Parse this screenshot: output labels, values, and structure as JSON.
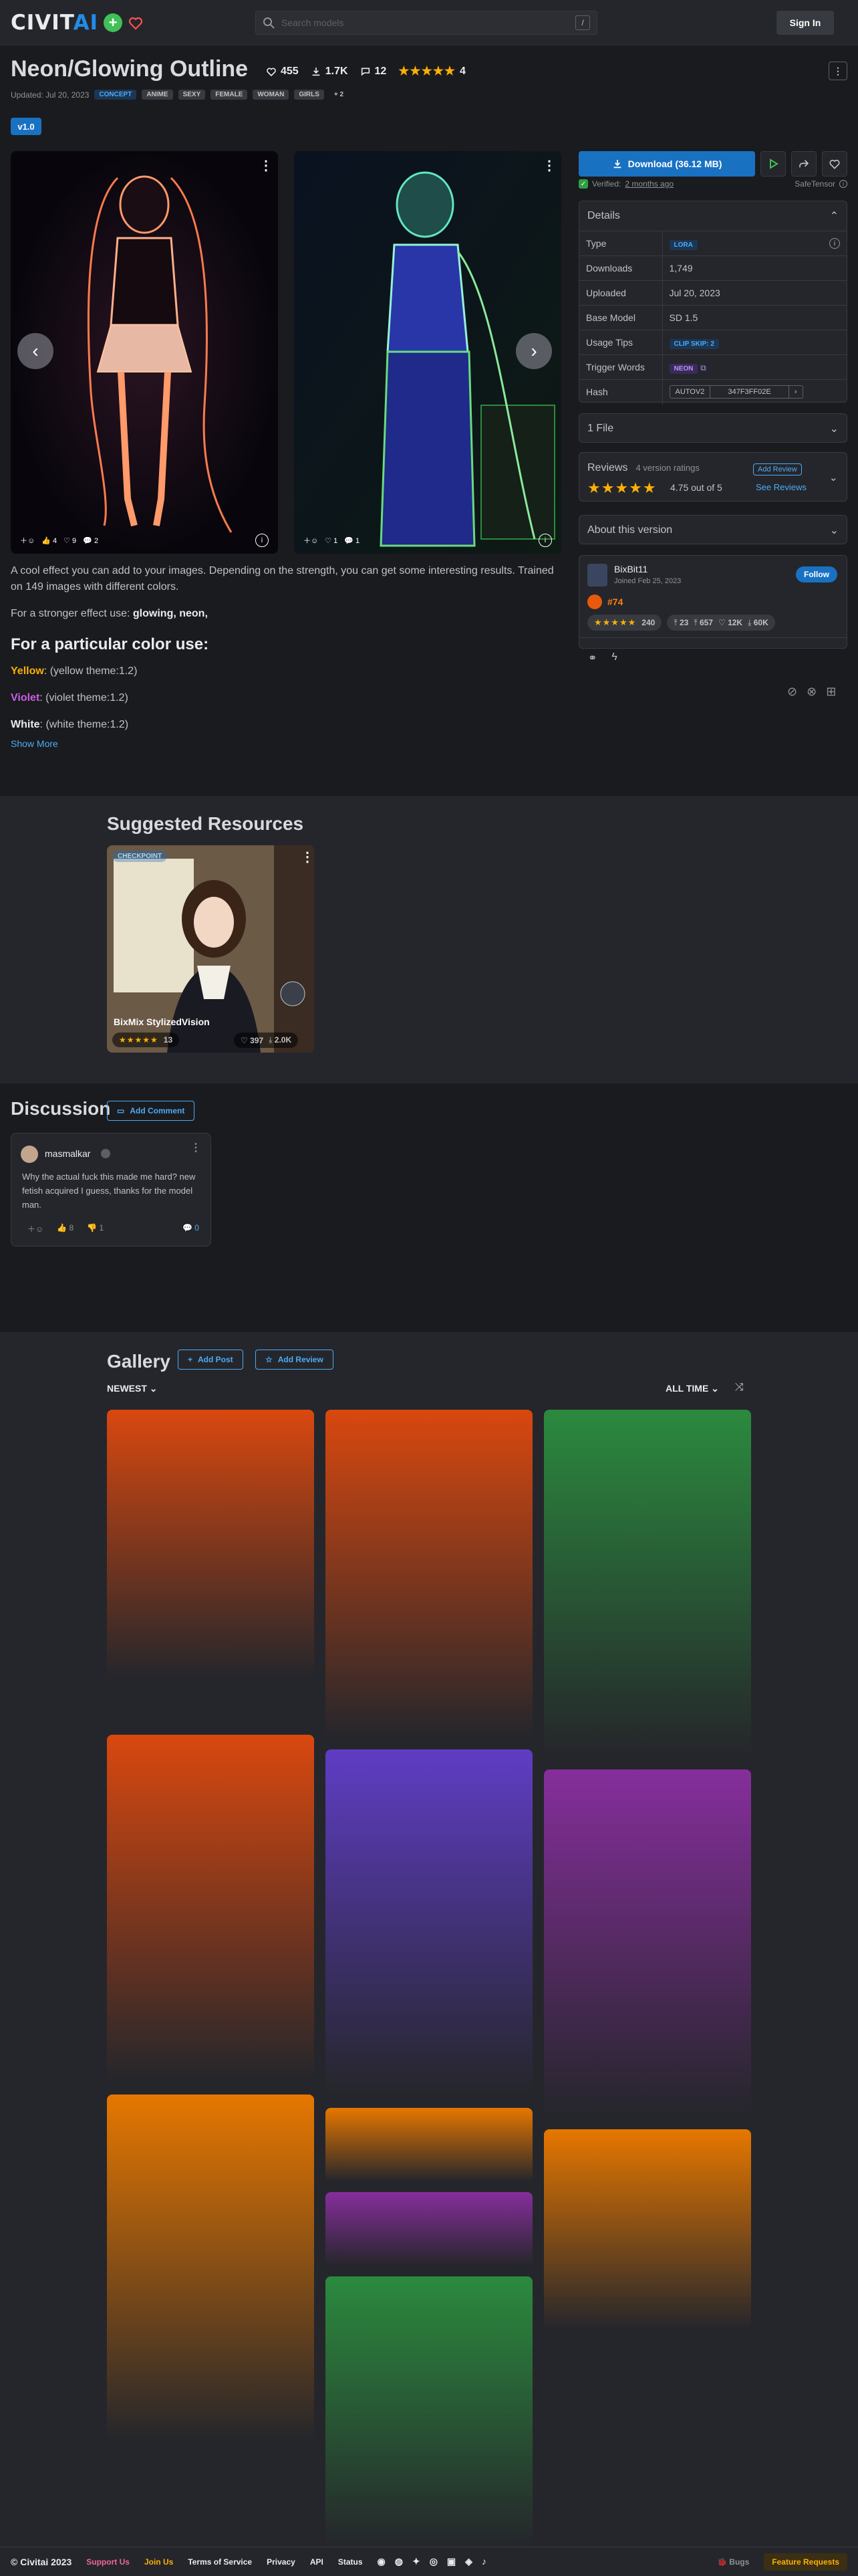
{
  "header": {
    "logo_main": "CIVIT",
    "logo_accent": "AI",
    "search_placeholder": "Search models",
    "search_shortcut": "/",
    "signin_label": "Sign In"
  },
  "model": {
    "title": "Neon/Glowing Outline",
    "likes": "455",
    "downloads": "1.7K",
    "comments": "12",
    "rating_stars": "★★★★★",
    "rating_count": "4",
    "updated": "Updated: Jul 20, 2023",
    "tags": [
      "CONCEPT",
      "ANIME",
      "SEXY",
      "FEMALE",
      "WOMAN",
      "GIRLS",
      "+ 2"
    ],
    "version_label": "v1.0",
    "menu_label": "⋮"
  },
  "carousel": {
    "images": [
      {
        "reactions": "4",
        "likes": "9",
        "comments": "2"
      },
      {
        "reactions": "1",
        "likes": "1",
        "comments": ""
      }
    ]
  },
  "description": {
    "p1": "A cool effect you can add to your images. Depending on the strength, you can get some interesting results. Trained on 149 images with different colors.",
    "p2_prefix": "For a stronger effect use: ",
    "p2_strong": "glowing, neon,",
    "heading": "For a particular color use:",
    "colors": [
      {
        "name": "Yellow",
        "rest": ": (yellow theme:1.2)",
        "color": "#fab005"
      },
      {
        "name": "Violet",
        "rest": ": (violet theme:1.2)",
        "color": "#cc5de8"
      },
      {
        "name": "White",
        "rest": ": (white theme:1.2)",
        "color": "#e9ecef"
      }
    ],
    "show_more": "Show More"
  },
  "download": {
    "label": "Download (36.12 MB)",
    "verified_prefix": "Verified: ",
    "verified_time": "2 months ago",
    "safetensor": "SafeTensor"
  },
  "details": {
    "title": "Details",
    "rows": [
      {
        "label": "Type",
        "value": "LORA"
      },
      {
        "label": "Downloads",
        "value": "1,749"
      },
      {
        "label": "Uploaded",
        "value": "Jul 20, 2023"
      },
      {
        "label": "Base Model",
        "value": "SD 1.5"
      },
      {
        "label": "Usage Tips",
        "value": "CLIP SKIP: 2"
      },
      {
        "label": "Trigger Words",
        "value": "NEON"
      },
      {
        "label": "Hash",
        "value": "AUTOV2",
        "hash": "347F3FF02E"
      }
    ]
  },
  "files": {
    "label": "1 File"
  },
  "reviews": {
    "title": "Reviews",
    "subtitle": "4 version ratings",
    "stars": "★★★★★",
    "score": "4.75 out of 5",
    "add_review": "Add Review",
    "see_reviews": "See Reviews"
  },
  "about": {
    "label": "About this version"
  },
  "creator": {
    "name": "BixBit11",
    "joined": "Joined Feb 25, 2023",
    "follow": "Follow",
    "rank": "#74",
    "stars": "★★★★★",
    "rating": "240",
    "uploads": "23",
    "downloads_up": "657",
    "likes": "12K",
    "downloads": "60K"
  },
  "suggested": {
    "title": "Suggested Resources",
    "card": {
      "badge": "CHECKPOINT",
      "name": "BixMix StylizedVision",
      "stars": "★★★★★",
      "rating": "13",
      "likes": "397",
      "downloads": "2.0K"
    }
  },
  "discussion": {
    "title": "Discussion",
    "add_comment": "Add Comment",
    "comment": {
      "user": "masmalkar",
      "text": "Why the actual fuck this made me hard? new fetish acquired I guess, thanks for the model man.",
      "likes": "8",
      "dislikes": "1",
      "replies": "0"
    }
  },
  "gallery": {
    "title": "Gallery",
    "add_post": "Add Post",
    "add_review": "Add Review",
    "sort": "NEWEST",
    "period": "ALL TIME"
  },
  "footer": {
    "copyright": "© Civitai 2023",
    "links": [
      "Support Us",
      "Join Us",
      "Terms of Service",
      "Privacy",
      "API",
      "Status"
    ],
    "bugs": "Bugs",
    "feature": "Feature Requests"
  },
  "colors": {
    "accent": "#228be6",
    "background": "#1a1b1e",
    "panel": "#25262b",
    "star": "#fab005"
  }
}
